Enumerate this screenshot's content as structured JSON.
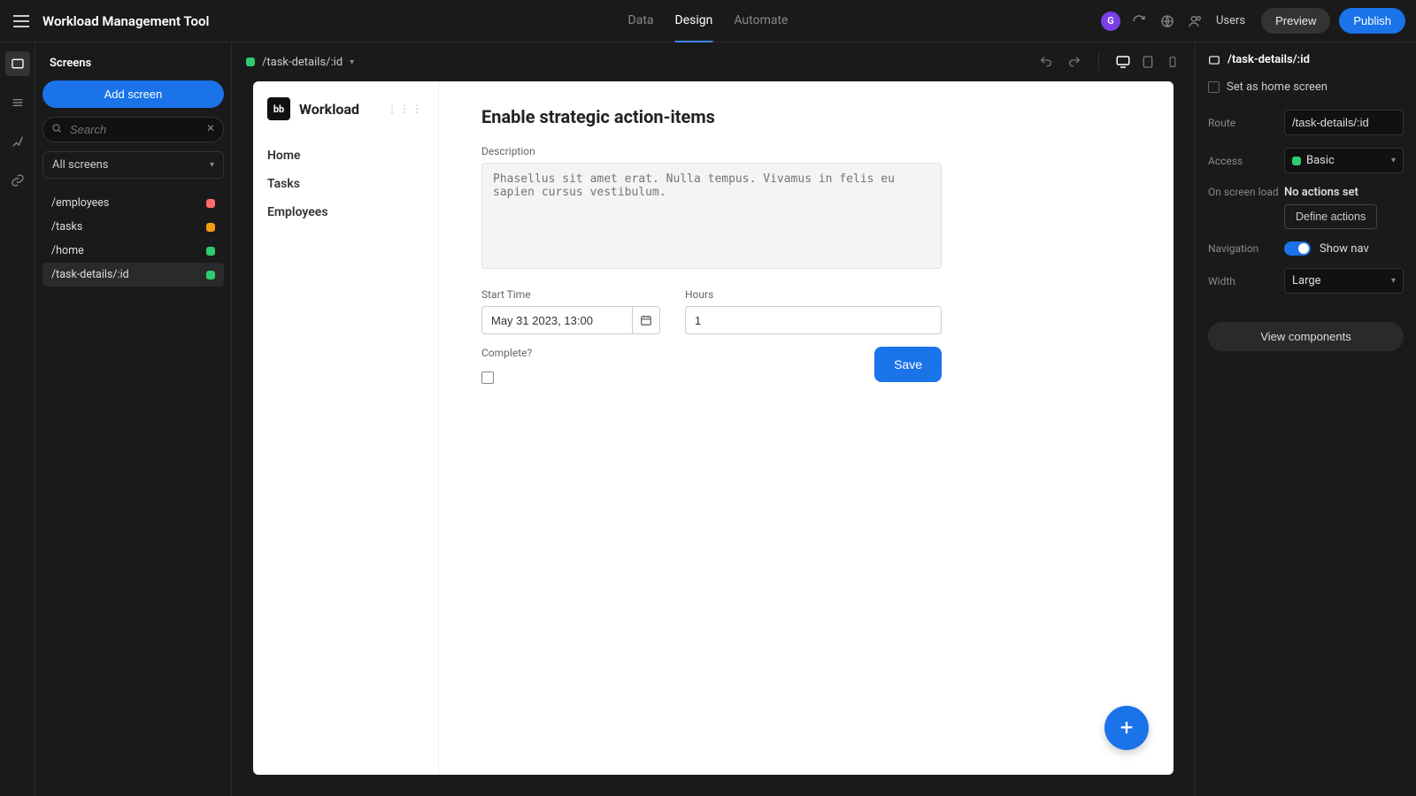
{
  "topbar": {
    "app_title": "Workload Management Tool",
    "tabs": {
      "data": "Data",
      "design": "Design",
      "automate": "Automate"
    },
    "avatar_initial": "G",
    "users_label": "Users",
    "preview": "Preview",
    "publish": "Publish"
  },
  "screens_panel": {
    "title": "Screens",
    "add_btn": "Add screen",
    "search_placeholder": "Search",
    "filter_value": "All screens",
    "items": [
      {
        "route": "/employees",
        "color": "#ff6b6b"
      },
      {
        "route": "/tasks",
        "color": "#f39c12"
      },
      {
        "route": "/home",
        "color": "#2ecc71"
      },
      {
        "route": "/task-details/:id",
        "color": "#2ecc71"
      }
    ],
    "selected_index": 3
  },
  "center": {
    "current_route": "/task-details/:id"
  },
  "canvas": {
    "brand_logo_text": "bb",
    "brand_name": "Workload",
    "nav": {
      "home": "Home",
      "tasks": "Tasks",
      "employees": "Employees"
    },
    "form": {
      "title": "Enable strategic action-items",
      "description_label": "Description",
      "description_placeholder": "Phasellus sit amet erat. Nulla tempus. Vivamus in felis eu sapien cursus vestibulum.",
      "start_time_label": "Start Time",
      "start_time_value": "May 31 2023, 13:00",
      "hours_label": "Hours",
      "hours_value": "1",
      "complete_label": "Complete?",
      "save_label": "Save"
    }
  },
  "inspector": {
    "header_route": "/task-details/:id",
    "set_home_label": "Set as home screen",
    "route_label": "Route",
    "route_value": "/task-details/:id",
    "access_label": "Access",
    "access_value": "Basic",
    "access_color": "#2ecc71",
    "on_load_label": "On screen load",
    "no_actions_text": "No actions set",
    "define_actions_label": "Define actions",
    "navigation_label": "Navigation",
    "show_nav_label": "Show nav",
    "width_label": "Width",
    "width_value": "Large",
    "view_components_label": "View components"
  }
}
